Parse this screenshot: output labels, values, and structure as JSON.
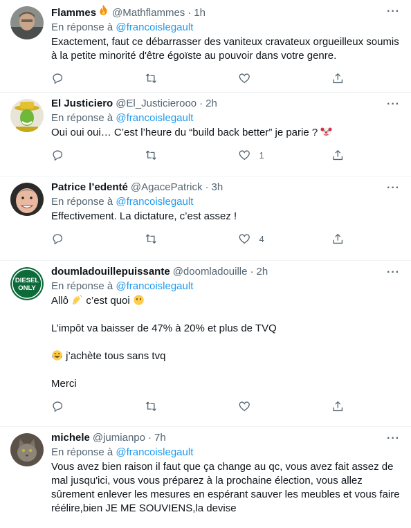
{
  "reply_prefix": "En réponse à",
  "tweets": [
    {
      "name": "Flammes",
      "name_emoji": "fire",
      "handle": "@Mathflammes",
      "time": "1h",
      "reply_to": "@francoislegault",
      "text_lines": [
        "Exactement, faut ce débarrasser des vaniteux cravateux orgueilleux soumis",
        "à la petite minorité d'être égoïste au pouvoir dans votre genre."
      ],
      "likes": ""
    },
    {
      "name": "El Justiciero",
      "handle": "@El_Justicierooo",
      "time": "2h",
      "reply_to": "@francoislegault",
      "text": "Oui oui oui… C’est l’heure du “build back better” je parie ?",
      "text_emoji": "clown-face",
      "likes": "1"
    },
    {
      "name": "Patrice l’edenté",
      "handle": "@AgacePatrick",
      "time": "3h",
      "reply_to": "@francoislegault",
      "text": "Effectivement. La dictature, c’est assez !",
      "likes": "4"
    },
    {
      "name": "doumladouillepuissante",
      "handle": "@doomladouille",
      "time": "2h",
      "reply_to": "@francoislegault",
      "avatar_text_1": "DIESEL",
      "avatar_text_2": "ONLY",
      "line1_a": "Allô",
      "line1_emoji_1": "waving-hand",
      "line1_b": "c’est quoi",
      "line1_emoji_2": "face-without-mouth",
      "line2": "L’impôt va baisser de 47% à 20% et plus de TVQ",
      "line3_emoji": "tears-of-joy",
      "line3": "j’achète tous sans tvq",
      "line4": "Merci",
      "likes": ""
    },
    {
      "name": "michele",
      "handle": "@jumianpo",
      "time": "7h",
      "reply_to": "@francoislegault",
      "text_lines": [
        "Vous avez bien raison il faut que ça change au qc, vous avez fait assez de",
        "mal jusqu'ici, vous vous préparez à la prochaine élection, vous allez",
        "sûrement enlever les mesures en espérant sauver les meubles et vous faire",
        "réélire,bien JE ME SOUVIENS,la devise"
      ]
    }
  ],
  "colors": {
    "link": "#1d9bf0",
    "secondary": "#536471",
    "text": "#0f1419",
    "divider": "#eff3f4"
  },
  "icons": [
    "reply-icon",
    "retweet-icon",
    "like-icon",
    "share-icon",
    "more-icon"
  ]
}
